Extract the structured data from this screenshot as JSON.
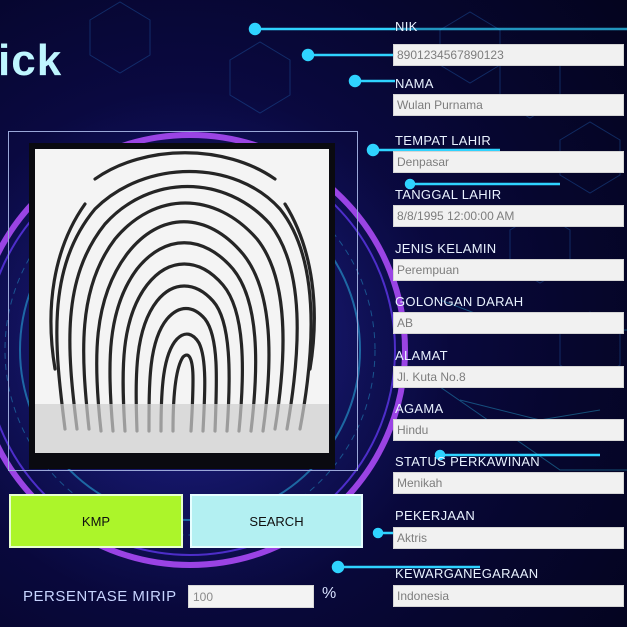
{
  "app": {
    "title": "ick"
  },
  "actions": {
    "kmp_label": "KMP",
    "search_label": "SEARCH"
  },
  "similarity": {
    "label": "PERSENTASE MIRIP",
    "value": "100",
    "unit": "%"
  },
  "fields": [
    {
      "label": "NIK",
      "value": "8901234567890123"
    },
    {
      "label": "NAMA",
      "value": "Wulan Purnama"
    },
    {
      "label": "TEMPAT LAHIR",
      "value": "Denpasar"
    },
    {
      "label": "TANGGAL LAHIR",
      "value": "8/8/1995 12:00:00 AM"
    },
    {
      "label": "JENIS KELAMIN",
      "value": "Perempuan"
    },
    {
      "label": "GOLONGAN DARAH",
      "value": "AB"
    },
    {
      "label": "ALAMAT",
      "value": "Jl. Kuta No.8"
    },
    {
      "label": "AGAMA",
      "value": "Hindu"
    },
    {
      "label": "STATUS PERKAWINAN",
      "value": "Menikah"
    },
    {
      "label": "PEKERJAAN",
      "value": "Aktris"
    },
    {
      "label": "KEWARGANEGARAAN",
      "value": "Indonesia"
    }
  ],
  "colors": {
    "kmp_button": "#acf52a",
    "search_button": "#b3f0f2",
    "accent": "#2fd3ff",
    "glow": "#b44dff"
  },
  "icons": {
    "fingerprint_image": "fingerprint-icon"
  }
}
